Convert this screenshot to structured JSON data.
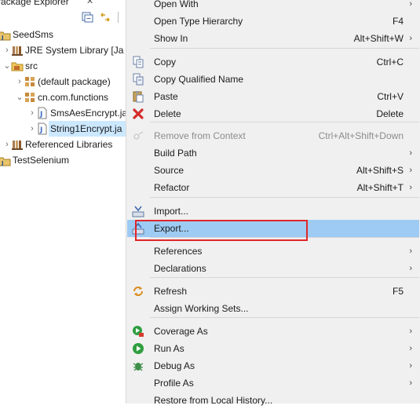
{
  "explorer": {
    "title": "Package Explorer",
    "close_glyph": "✕",
    "toolbar": {
      "icons": [
        "collapse-all-icon",
        "link-with-editor-icon"
      ]
    },
    "tree": [
      {
        "label": "SeedSms",
        "icon": "java-project-icon",
        "twisty": "expanded"
      },
      {
        "label": "JRE System Library [Ja",
        "icon": "library-icon",
        "twisty": "collapsed"
      },
      {
        "label": "src",
        "icon": "source-folder-icon",
        "twisty": "expanded"
      },
      {
        "label": "(default package)",
        "icon": "package-icon",
        "twisty": "collapsed"
      },
      {
        "label": "cn.com.functions",
        "icon": "package-icon",
        "twisty": "expanded"
      },
      {
        "label": "SmsAesEncrypt.ja",
        "icon": "java-file-icon",
        "twisty": "collapsed"
      },
      {
        "label": "String1Encrypt.ja",
        "icon": "java-file-icon",
        "twisty": "collapsed",
        "selected": true
      },
      {
        "label": "Referenced Libraries",
        "icon": "library-icon",
        "twisty": "collapsed"
      },
      {
        "label": "TestSelenium",
        "icon": "java-project-icon",
        "twisty": "none"
      }
    ]
  },
  "menu": {
    "items": [
      {
        "id": "open-with",
        "label": "Open With",
        "shortcut": "",
        "submenu": true,
        "icon": ""
      },
      {
        "id": "open-type-hierarchy",
        "label": "Open Type Hierarchy",
        "shortcut": "F4",
        "submenu": false,
        "icon": ""
      },
      {
        "id": "show-in",
        "label": "Show In",
        "shortcut": "Alt+Shift+W",
        "submenu": true,
        "icon": ""
      },
      {
        "id": "copy",
        "label": "Copy",
        "shortcut": "Ctrl+C",
        "submenu": false,
        "icon": "copy-icon"
      },
      {
        "id": "copy-qualified-name",
        "label": "Copy Qualified Name",
        "shortcut": "",
        "submenu": false,
        "icon": "copy-qualified-name-icon"
      },
      {
        "id": "paste",
        "label": "Paste",
        "shortcut": "Ctrl+V",
        "submenu": false,
        "icon": "paste-icon"
      },
      {
        "id": "delete",
        "label": "Delete",
        "shortcut": "Delete",
        "submenu": false,
        "icon": "delete-icon"
      },
      {
        "id": "remove-from-context",
        "label": "Remove from Context",
        "shortcut": "Ctrl+Alt+Shift+Down",
        "submenu": false,
        "icon": "remove-from-context-icon",
        "disabled": true
      },
      {
        "id": "build-path",
        "label": "Build Path",
        "shortcut": "",
        "submenu": true,
        "icon": ""
      },
      {
        "id": "source",
        "label": "Source",
        "shortcut": "Alt+Shift+S",
        "submenu": true,
        "icon": ""
      },
      {
        "id": "refactor",
        "label": "Refactor",
        "shortcut": "Alt+Shift+T",
        "submenu": true,
        "icon": ""
      },
      {
        "id": "import",
        "label": "Import...",
        "shortcut": "",
        "submenu": false,
        "icon": "import-icon"
      },
      {
        "id": "export",
        "label": "Export...",
        "shortcut": "",
        "submenu": false,
        "icon": "export-icon",
        "highlighted": true
      },
      {
        "id": "references",
        "label": "References",
        "shortcut": "",
        "submenu": true,
        "icon": ""
      },
      {
        "id": "declarations",
        "label": "Declarations",
        "shortcut": "",
        "submenu": true,
        "icon": ""
      },
      {
        "id": "refresh",
        "label": "Refresh",
        "shortcut": "F5",
        "submenu": false,
        "icon": "refresh-icon"
      },
      {
        "id": "assign-working-sets",
        "label": "Assign Working Sets...",
        "shortcut": "",
        "submenu": false,
        "icon": ""
      },
      {
        "id": "coverage-as",
        "label": "Coverage As",
        "shortcut": "",
        "submenu": true,
        "icon": "coverage-icon"
      },
      {
        "id": "run-as",
        "label": "Run As",
        "shortcut": "",
        "submenu": true,
        "icon": "run-icon"
      },
      {
        "id": "debug-as",
        "label": "Debug As",
        "shortcut": "",
        "submenu": true,
        "icon": "debug-icon"
      },
      {
        "id": "profile-as",
        "label": "Profile As",
        "shortcut": "",
        "submenu": true,
        "icon": ""
      },
      {
        "id": "restore-from-local-history",
        "label": "Restore from Local History...",
        "shortcut": "",
        "submenu": false,
        "icon": ""
      }
    ],
    "submenu_arrow": "›"
  },
  "colors": {
    "selection": "#cce8ff",
    "menu_highlight": "#9ecbf3",
    "menu_background": "#f0f0f0",
    "annotation": "#e0262a"
  }
}
